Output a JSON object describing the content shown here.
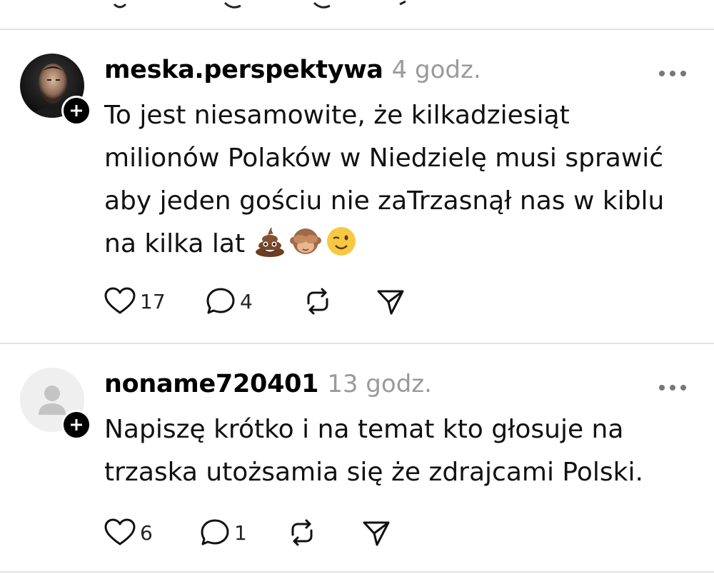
{
  "posts": [
    {
      "username": "meska.perspektywa",
      "time": "4 godz.",
      "text": "To jest niesamowite, że kilkadziesiąt milionów Polaków w Niedzielę musi sprawić aby jeden gościu nie zaTrzasnął nas w kiblu na kilka lat",
      "emojis": [
        "poop-emoji",
        "see-no-evil-monkey-emoji",
        "winking-face-emoji"
      ],
      "likes": "17",
      "replies": "4",
      "avatar": "photo"
    },
    {
      "username": "noname720401",
      "time": "13 godz.",
      "text": "Napiszę krótko i na temat kto głosuje na trzaska utożsamia się że zdrajcami Polski.",
      "likes": "6",
      "replies": "1",
      "avatar": "placeholder"
    }
  ],
  "icons": {
    "like": "heart-icon",
    "reply": "comment-icon",
    "repost": "repost-icon",
    "share": "send-icon",
    "more": "more-icon",
    "follow": "plus-icon"
  },
  "colors": {
    "text": "#000000",
    "muted": "#9a9a9a",
    "divider": "#e3e3e3",
    "badge": "#000000"
  }
}
